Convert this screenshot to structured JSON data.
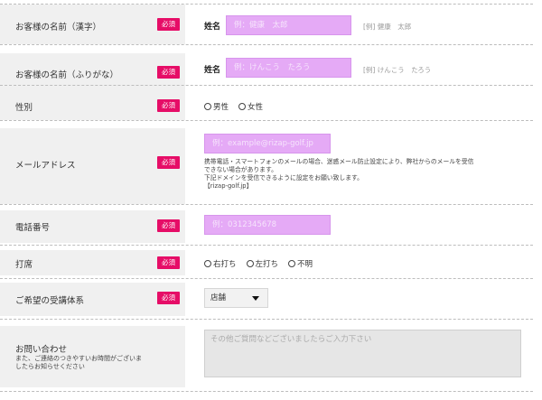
{
  "required_label": "必須",
  "fields": {
    "name_kanji": {
      "label": "お客様の名前（漢字）",
      "prefix": "姓名",
      "placeholder": "例：健康　太郎",
      "example": "[例] 健康　太郎"
    },
    "name_kana": {
      "label": "お客様の名前（ふりがな）",
      "prefix": "姓名",
      "placeholder": "例：けんこう　たろう",
      "example": "[例] けんこう　たろう"
    },
    "gender": {
      "label": "性別",
      "options": [
        "男性",
        "女性"
      ]
    },
    "email": {
      "label": "メールアドレス",
      "placeholder": "例：example@rizap-golf.jp",
      "note_lines": [
        "携帯電話・スマートフォンのメールの場合、迷惑メール防止設定により、弊社からのメールを受信",
        "できない場合があります。",
        "下記ドメインを受信できるように設定をお願い致します。",
        "【rizap-golf.jp】"
      ]
    },
    "phone": {
      "label": "電話番号",
      "placeholder": "例：0312345678"
    },
    "batting": {
      "label": "打席",
      "options": [
        "右打ち",
        "左打ち",
        "不明"
      ]
    },
    "course": {
      "label": "ご希望の受講体系",
      "selected": "店舗"
    },
    "inquiry": {
      "label": "お問い合わせ",
      "sub_lines": [
        "また、ご連絡のつきやすいお時間がございま",
        "したらお知らせください"
      ],
      "placeholder": "その他ご質問などございましたらご入力下さい"
    }
  },
  "colors": {
    "required_badge": "#e60d67",
    "input_fill": "#e5aaf6",
    "label_background": "#f0f0f0"
  }
}
